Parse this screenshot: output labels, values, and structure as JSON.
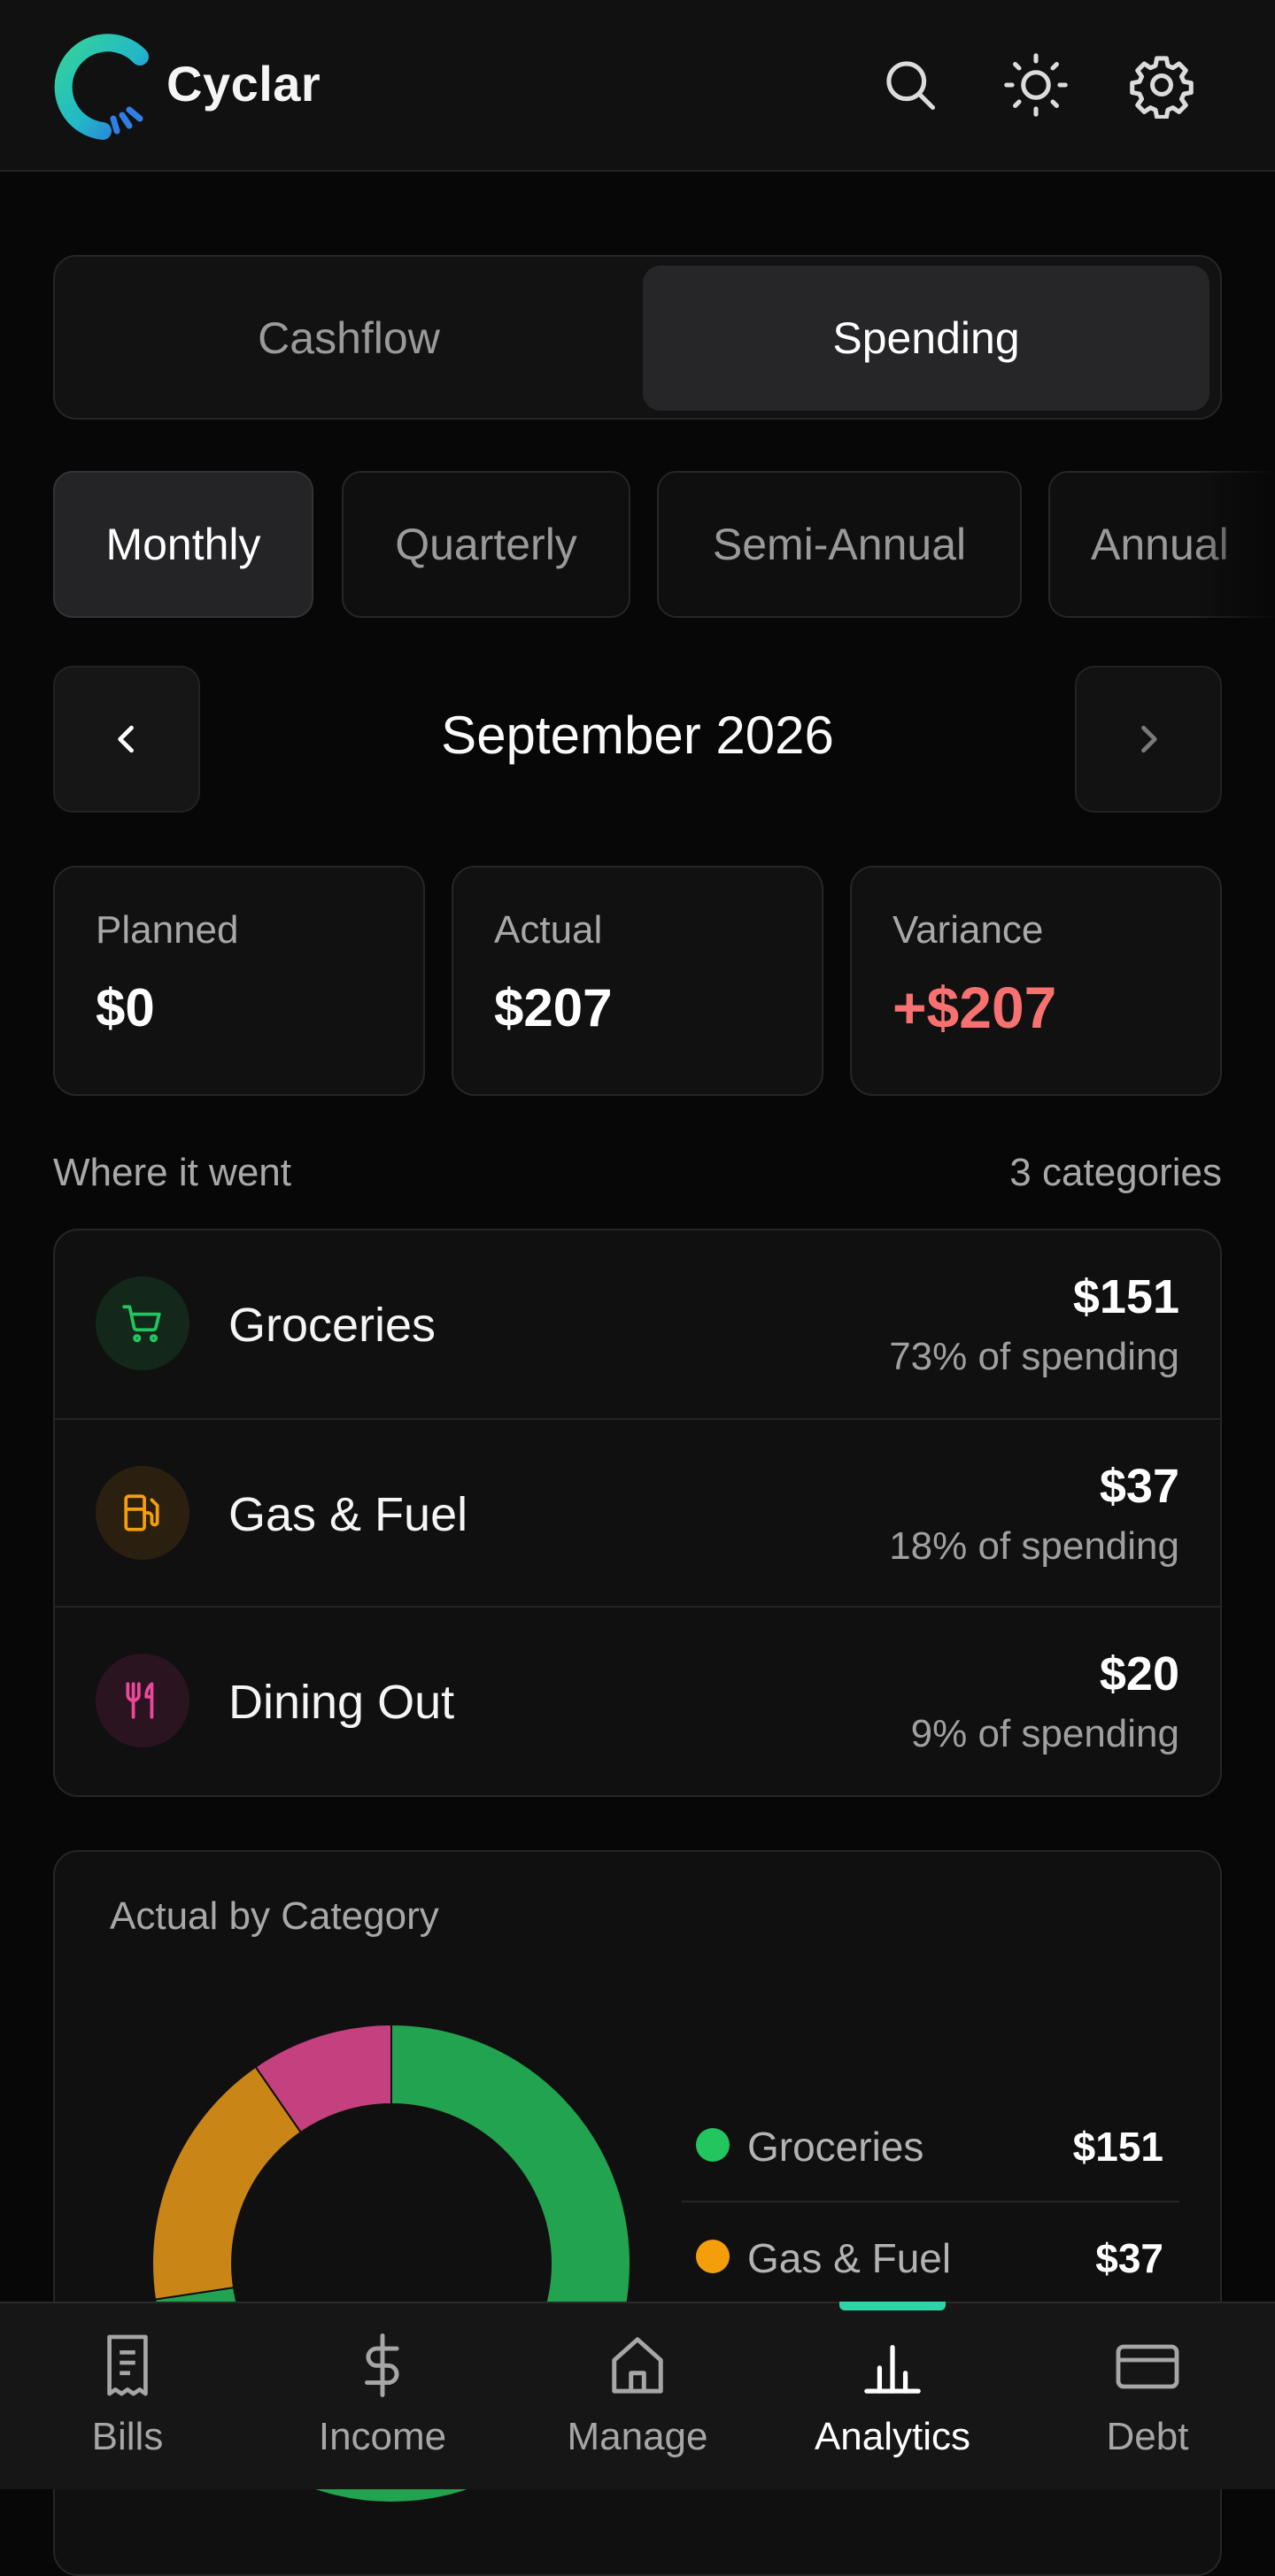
{
  "app": {
    "name": "Cyclar"
  },
  "header": {
    "icons": [
      "search-icon",
      "sun-icon",
      "gear-icon"
    ]
  },
  "view_toggle": {
    "options": [
      "Cashflow",
      "Spending"
    ],
    "selected": "Spending"
  },
  "periods": {
    "options": [
      "Monthly",
      "Quarterly",
      "Semi-Annual",
      "Annual"
    ],
    "selected": "Monthly"
  },
  "month_nav": {
    "label": "September 2026"
  },
  "stats": {
    "planned": {
      "label": "Planned",
      "value": "$0"
    },
    "actual": {
      "label": "Actual",
      "value": "$207"
    },
    "variance": {
      "label": "Variance",
      "value": "+$207",
      "color": "#f87171"
    }
  },
  "where": {
    "title": "Where it went",
    "count": "3 categories",
    "items": [
      {
        "name": "Groceries",
        "amount": "$151",
        "pct": "73% of spending",
        "icon": "cart-icon",
        "color": "#22c55e",
        "bg": "#13271a"
      },
      {
        "name": "Gas & Fuel",
        "amount": "$37",
        "pct": "18% of spending",
        "icon": "fuel-icon",
        "color": "#f59e0b",
        "bg": "#2b2010"
      },
      {
        "name": "Dining Out",
        "amount": "$20",
        "pct": "9% of spending",
        "icon": "utensils-icon",
        "color": "#ec4899",
        "bg": "#2a1420"
      }
    ]
  },
  "chart_card": {
    "title": "Actual by Category",
    "legend": [
      {
        "name": "Groceries",
        "value": "$151",
        "color": "#22c55e"
      },
      {
        "name": "Gas & Fuel",
        "value": "$37",
        "color": "#f59e0b"
      }
    ]
  },
  "chart_data": {
    "type": "pie",
    "categories": [
      "Groceries",
      "Gas & Fuel",
      "Dining Out"
    ],
    "values": [
      151,
      37,
      20
    ],
    "colors": [
      "#22a34f",
      "#c98616",
      "#c4407f"
    ]
  },
  "bottom_nav": {
    "tabs": [
      {
        "label": "Bills",
        "icon": "receipt-icon"
      },
      {
        "label": "Income",
        "icon": "dollar-icon"
      },
      {
        "label": "Manage",
        "icon": "home-icon"
      },
      {
        "label": "Analytics",
        "icon": "bar-chart-icon"
      },
      {
        "label": "Debt",
        "icon": "card-icon"
      }
    ],
    "active": "Analytics"
  }
}
